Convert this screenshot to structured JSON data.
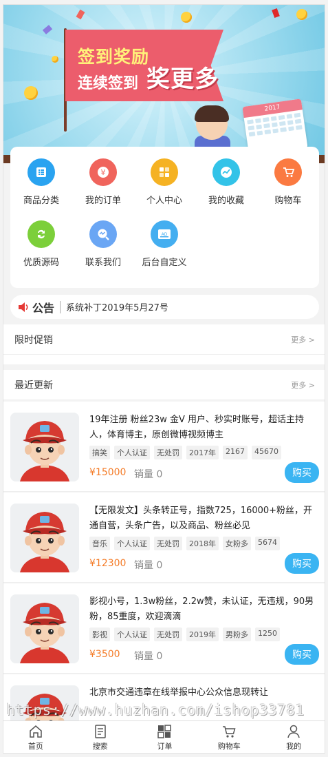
{
  "banner": {
    "line1": "签到奖励",
    "line2": "连续签到",
    "line3": "奖更多",
    "calendar_year": "2017"
  },
  "categories": [
    {
      "label": "商品分类",
      "icon": "list-icon",
      "color": "#2aa3f0"
    },
    {
      "label": "我的订单",
      "icon": "yen-icon",
      "color": "#f0645c"
    },
    {
      "label": "个人中心",
      "icon": "apps-icon",
      "color": "#f5b223"
    },
    {
      "label": "我的收藏",
      "icon": "trend-icon",
      "color": "#33c3e8"
    },
    {
      "label": "购物车",
      "icon": "cart-icon",
      "color": "#fb7a41"
    },
    {
      "label": "优质源码",
      "icon": "refresh-icon",
      "color": "#7ccf3a"
    },
    {
      "label": "联系我们",
      "icon": "search-chart-icon",
      "color": "#6aa6f4"
    },
    {
      "label": "后台自定义",
      "icon": "ad-icon",
      "color": "#44aef0"
    }
  ],
  "notice": {
    "title": "公告",
    "text": "系统补丁2019年5月27号"
  },
  "promo": {
    "title": "限时促销",
    "more": "更多 >"
  },
  "recent": {
    "title": "最近更新",
    "more": "更多 >"
  },
  "items": [
    {
      "title": "19年注册 粉丝23w 金V 用户、秒实时账号，超话主持人，体育博主，原创微博视频博主",
      "tags": [
        "搞笑",
        "个人认证",
        "无处罚",
        "2017年",
        "2167",
        "45670"
      ],
      "price": "¥15000",
      "sales": "销量 0",
      "buy": "购买"
    },
    {
      "title": "【无限发文】头条转正号，指数725，16000+粉丝，开通自营，头条广告，以及商品、粉丝必见",
      "tags": [
        "音乐",
        "个人认证",
        "无处罚",
        "2018年",
        "女粉多",
        "5674"
      ],
      "price": "¥12300",
      "sales": "销量 0",
      "buy": "购买"
    },
    {
      "title": "影视小号，1.3w粉丝，2.2w赞，未认证，无违规，90男粉，85重度，欢迎滴滴",
      "tags": [
        "影视",
        "个人认证",
        "无处罚",
        "2019年",
        "男粉多",
        "1250"
      ],
      "price": "¥3500",
      "sales": "销量 0",
      "buy": "购买"
    },
    {
      "title": "北京市交通违章在线举报中心公众信息现转让",
      "tags": [],
      "price": "",
      "sales": "",
      "buy": ""
    }
  ],
  "watermark": "https://www.huzhan.com/ishop33781",
  "tabbar": [
    {
      "label": "首页",
      "icon": "home-icon"
    },
    {
      "label": "搜索",
      "icon": "document-icon"
    },
    {
      "label": "订单",
      "icon": "grid-icon"
    },
    {
      "label": "购物车",
      "icon": "cart-icon"
    },
    {
      "label": "我的",
      "icon": "user-icon"
    }
  ],
  "colors": {
    "accent": "#3ab4f2",
    "price": "#f47b27"
  }
}
